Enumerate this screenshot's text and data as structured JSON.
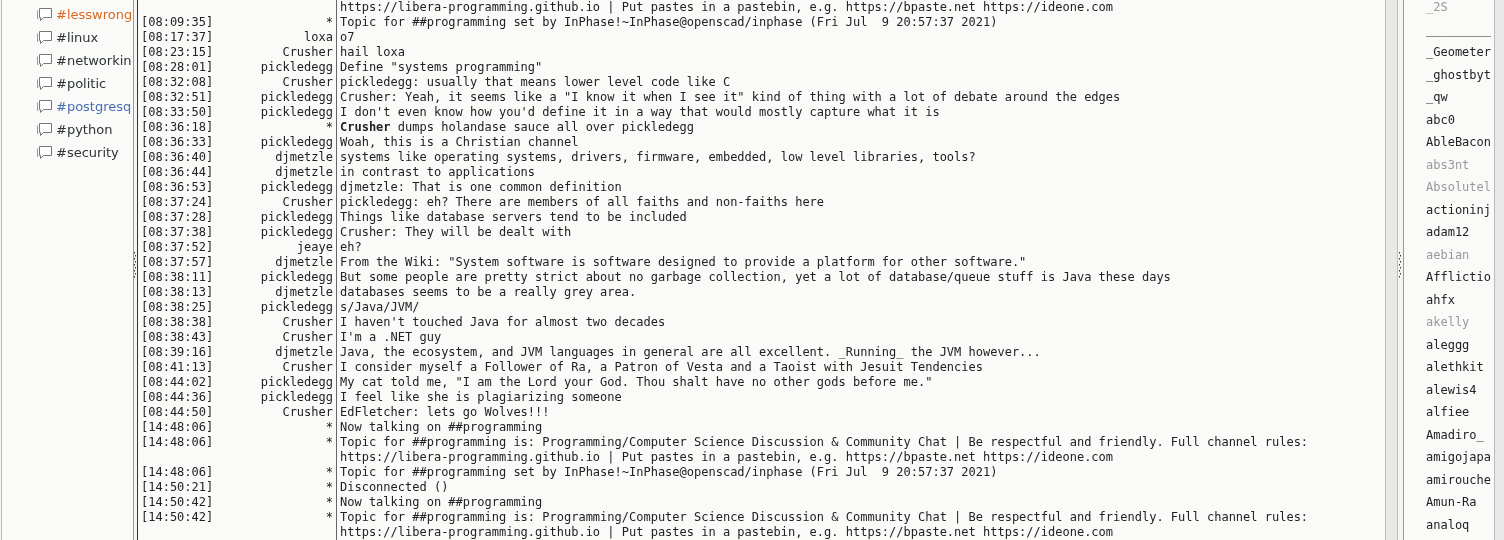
{
  "channels": [
    {
      "name": "#lesswrong",
      "color": "#d8691f"
    },
    {
      "name": "#linux",
      "color": "#2e3436"
    },
    {
      "name": "#networkin",
      "color": "#2e3436"
    },
    {
      "name": "#politic",
      "color": "#2e3436"
    },
    {
      "name": "#postgresq",
      "color": "#4a6db3"
    },
    {
      "name": "#python",
      "color": "#2e3436"
    },
    {
      "name": "#security",
      "color": "#2e3436"
    }
  ],
  "messages": [
    {
      "lines": [
        "https://libera-programming.github.io | Put pastes in a pastebin, e.g. https://bpaste.net https://ideone.com"
      ]
    },
    {
      "time": "[08:09:35]",
      "nick": "*",
      "lines": [
        "Topic for ##programming set by InPhase!~InPhase@openscad/inphase (Fri Jul  9 20:57:37 2021)"
      ]
    },
    {
      "time": "[08:17:37]",
      "nick": "loxa",
      "lines": [
        "o7"
      ]
    },
    {
      "time": "[08:23:15]",
      "nick": "Crusher",
      "lines": [
        "hail loxa"
      ]
    },
    {
      "time": "[08:28:01]",
      "nick": "pickledegg",
      "lines": [
        "Define \"systems programming\""
      ]
    },
    {
      "time": "[08:32:08]",
      "nick": "Crusher",
      "lines": [
        "pickledegg: usually that means lower level code like C"
      ]
    },
    {
      "time": "[08:32:51]",
      "nick": "pickledegg",
      "lines": [
        "Crusher: Yeah, it seems like a \"I know it when I see it\" kind of thing with a lot of debate around the edges"
      ]
    },
    {
      "time": "[08:33:50]",
      "nick": "pickledegg",
      "lines": [
        "I don't even know how you'd define it in a way that would mostly capture what it is"
      ]
    },
    {
      "time": "[08:36:18]",
      "nick": "*",
      "lines": [
        "**Crusher** dumps holandase sauce all over pickledegg"
      ]
    },
    {
      "time": "[08:36:33]",
      "nick": "pickledegg",
      "lines": [
        "Woah, this is a Christian channel"
      ]
    },
    {
      "time": "[08:36:40]",
      "nick": "djmetzle",
      "lines": [
        "systems like operating systems, drivers, firmware, embedded, low level libraries, tools?"
      ]
    },
    {
      "time": "[08:36:44]",
      "nick": "djmetzle",
      "lines": [
        "in contrast to applications"
      ]
    },
    {
      "time": "[08:36:53]",
      "nick": "pickledegg",
      "lines": [
        "djmetzle: That is one common definition"
      ]
    },
    {
      "time": "[08:37:24]",
      "nick": "Crusher",
      "lines": [
        "pickledegg: eh? There are members of all faiths and non-faiths here"
      ]
    },
    {
      "time": "[08:37:28]",
      "nick": "pickledegg",
      "lines": [
        "Things like database servers tend to be included"
      ]
    },
    {
      "time": "[08:37:38]",
      "nick": "pickledegg",
      "lines": [
        "Crusher: They will be dealt with"
      ]
    },
    {
      "time": "[08:37:52]",
      "nick": "jeaye",
      "lines": [
        "eh?"
      ]
    },
    {
      "time": "[08:37:57]",
      "nick": "djmetzle",
      "lines": [
        "From the Wiki: \"System software is software designed to provide a platform for other software.\""
      ]
    },
    {
      "time": "[08:38:11]",
      "nick": "pickledegg",
      "lines": [
        "But some people are pretty strict about no garbage collection, yet a lot of database/queue stuff is Java these days"
      ]
    },
    {
      "time": "[08:38:13]",
      "nick": "djmetzle",
      "lines": [
        "databases seems to be a really grey area."
      ]
    },
    {
      "time": "[08:38:25]",
      "nick": "pickledegg",
      "lines": [
        "s/Java/JVM/"
      ]
    },
    {
      "time": "[08:38:38]",
      "nick": "Crusher",
      "lines": [
        "I haven't touched Java for almost two decades"
      ]
    },
    {
      "time": "[08:38:43]",
      "nick": "Crusher",
      "lines": [
        "I'm a .NET guy"
      ]
    },
    {
      "time": "[08:39:16]",
      "nick": "djmetzle",
      "lines": [
        "Java, the ecosystem, and JVM languages in general are all excellent. _Running_ the JVM however..."
      ]
    },
    {
      "time": "[08:41:13]",
      "nick": "Crusher",
      "lines": [
        "I consider myself a Follower of Ra, a Patron of Vesta and a Taoist with Jesuit Tendencies"
      ]
    },
    {
      "time": "[08:44:02]",
      "nick": "pickledegg",
      "lines": [
        "My cat told me, \"I am the Lord your God. Thou shalt have no other gods before me.\""
      ]
    },
    {
      "time": "[08:44:36]",
      "nick": "pickledegg",
      "lines": [
        "I feel like she is plagiarizing someone"
      ]
    },
    {
      "time": "[08:44:50]",
      "nick": "Crusher",
      "lines": [
        "EdFletcher: lets go Wolves!!!"
      ]
    },
    {
      "time": "[14:48:06]",
      "nick": "*",
      "lines": [
        "Now talking on ##programming"
      ]
    },
    {
      "time": "[14:48:06]",
      "nick": "*",
      "lines": [
        "Topic for ##programming is: Programming/Computer Science Discussion & Community Chat | Be respectful and friendly. Full channel rules:",
        "https://libera-programming.github.io | Put pastes in a pastebin, e.g. https://bpaste.net https://ideone.com"
      ]
    },
    {
      "time": "[14:48:06]",
      "nick": "*",
      "lines": [
        "Topic for ##programming set by InPhase!~InPhase@openscad/inphase (Fri Jul  9 20:57:37 2021)"
      ]
    },
    {
      "time": "[14:50:21]",
      "nick": "*",
      "lines": [
        "Disconnected ()"
      ]
    },
    {
      "time": "[14:50:42]",
      "nick": "*",
      "lines": [
        "Now talking on ##programming"
      ]
    },
    {
      "time": "[14:50:42]",
      "nick": "*",
      "lines": [
        "Topic for ##programming is: Programming/Computer Science Discussion & Community Chat | Be respectful and friendly. Full channel rules:",
        "https://libera-programming.github.io | Put pastes in a pastebin, e.g. https://bpaste.net https://ideone.com"
      ]
    }
  ],
  "users": [
    {
      "nick": "_2S",
      "away": true
    },
    {
      "nick": "_________",
      "away": false
    },
    {
      "nick": "_Geometer",
      "away": false
    },
    {
      "nick": "_ghostbyt",
      "away": false
    },
    {
      "nick": "_qw",
      "away": false
    },
    {
      "nick": "abc0",
      "away": false
    },
    {
      "nick": "AbleBacon",
      "away": false
    },
    {
      "nick": "abs3nt",
      "away": true
    },
    {
      "nick": "Absolutel",
      "away": true
    },
    {
      "nick": "actioninj",
      "away": false
    },
    {
      "nick": "adam12",
      "away": false
    },
    {
      "nick": "aebian",
      "away": true
    },
    {
      "nick": "Afflictio",
      "away": false
    },
    {
      "nick": "ahfx",
      "away": false
    },
    {
      "nick": "akelly",
      "away": true
    },
    {
      "nick": "aleggg",
      "away": false
    },
    {
      "nick": "alethkit",
      "away": false
    },
    {
      "nick": "alewis4",
      "away": false
    },
    {
      "nick": "alfiee",
      "away": false
    },
    {
      "nick": "Amadiro_",
      "away": false
    },
    {
      "nick": "amigojapa",
      "away": false
    },
    {
      "nick": "amirouche",
      "away": false
    },
    {
      "nick": "Amun-Ra",
      "away": false
    },
    {
      "nick": "analoq",
      "away": false
    }
  ]
}
